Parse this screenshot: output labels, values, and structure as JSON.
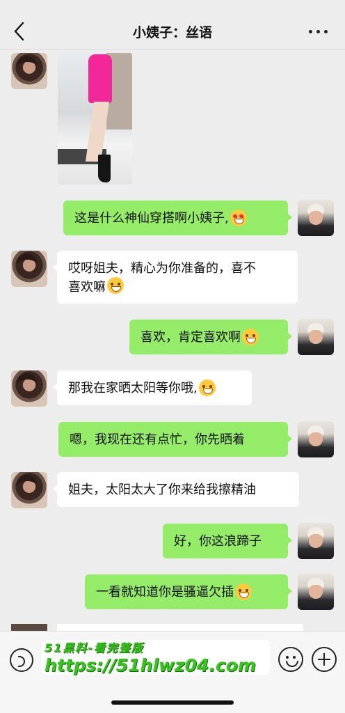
{
  "header": {
    "title": "小姨子：丝语"
  },
  "messages": [
    {
      "side": "in",
      "type": "image",
      "alt": ""
    },
    {
      "side": "out",
      "text": "这是什么神仙穿搭啊小姨子,",
      "emoji": "heart-eyes-emoji"
    },
    {
      "side": "in",
      "line1": "哎呀姐夫，精心为你准备的，喜不",
      "line2": "喜欢嘛",
      "emoji": "grin-emoji"
    },
    {
      "side": "out",
      "text": "喜欢，肯定喜欢啊",
      "emoji": "smile-emoji"
    },
    {
      "side": "in",
      "text": "那我在家晒太阳等你哦,",
      "emoji": "grin-emoji"
    },
    {
      "side": "out",
      "text": "嗯，我现在还有点忙，你先晒着"
    },
    {
      "side": "in",
      "text": "姐夫，太阳太大了你来给我擦精油"
    },
    {
      "side": "out",
      "text": "好，你这浪蹄子"
    },
    {
      "side": "out",
      "text": "一看就知道你是骚逼欠插",
      "emoji": "grin-emoji"
    }
  ],
  "watermark": {
    "line1": "51黑料-看完整版",
    "line2": "https://51hlwz04.com"
  },
  "icons": {
    "back": "chevron-left-icon",
    "more": "more-dots-icon",
    "voice": "voice-icon",
    "emoji": "emoji-icon",
    "plus": "plus-icon"
  }
}
